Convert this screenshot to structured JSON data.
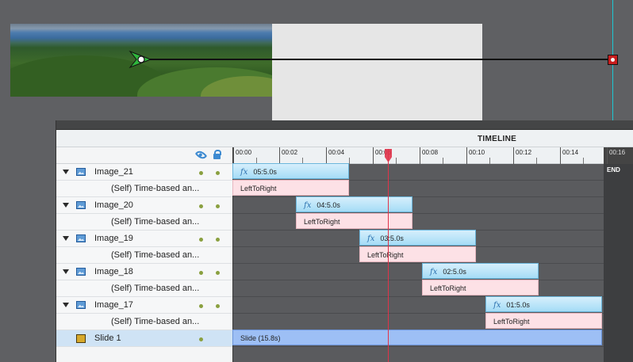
{
  "timeline": {
    "title": "TIMELINE",
    "time_ticks": [
      "00:00",
      "00:02",
      "00:04",
      "00:06",
      "00:08",
      "00:10",
      "00:12",
      "00:14",
      "00:16"
    ],
    "end_label": "END"
  },
  "elements": [
    {
      "name": "Image_21",
      "sub_label": "(Self) Time-based an...",
      "anim_label": "05:5.0s",
      "sub_bar_label": "LeftToRight"
    },
    {
      "name": "Image_20",
      "sub_label": "(Self) Time-based an...",
      "anim_label": "04:5.0s",
      "sub_bar_label": "LeftToRight"
    },
    {
      "name": "Image_19",
      "sub_label": "(Self) Time-based an...",
      "anim_label": "03:5.0s",
      "sub_bar_label": "LeftToRight"
    },
    {
      "name": "Image_18",
      "sub_label": "(Self) Time-based an...",
      "anim_label": "02:5.0s",
      "sub_bar_label": "LeftToRight"
    },
    {
      "name": "Image_17",
      "sub_label": "(Self) Time-based an...",
      "anim_label": "01:5.0s",
      "sub_bar_label": "LeftToRight"
    }
  ],
  "slide": {
    "name": "Slide 1",
    "bar_label": "Slide (15.8s)"
  },
  "colors": {
    "playhead": "#e0334a",
    "guide": "#1cc8d4",
    "anim_bar": "#a5dcf6",
    "effect_bar": "#fde1e6",
    "slide_bar": "#9dbff5",
    "accent_icon": "#3d8ad1"
  }
}
